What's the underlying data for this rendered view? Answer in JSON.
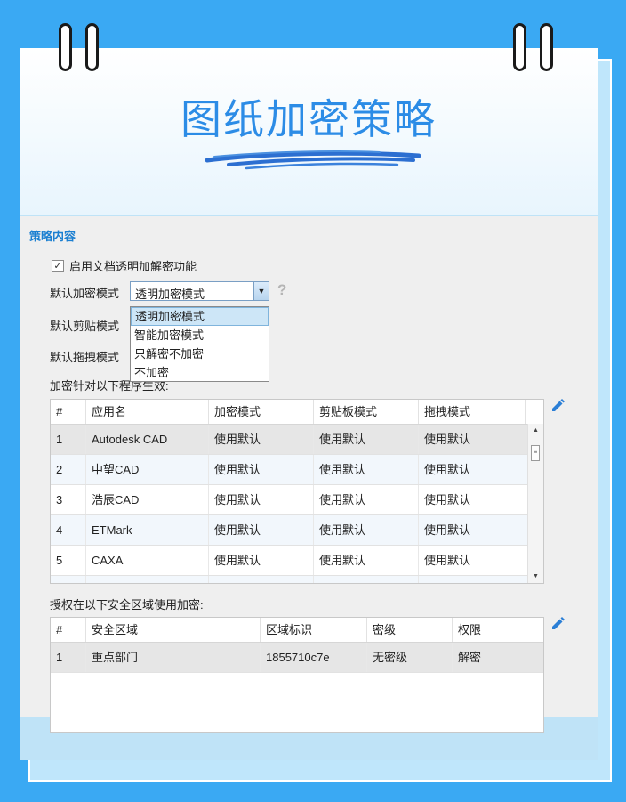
{
  "header": {
    "title": "图纸加密策略"
  },
  "policy": {
    "section_title": "策略内容",
    "enable_checkbox": {
      "label": "启用文档透明加解密功能",
      "checked": true
    },
    "encrypt_mode": {
      "label": "默认加密模式",
      "value": "透明加密模式",
      "options": [
        "透明加密模式",
        "智能加密模式",
        "只解密不加密",
        "不加密"
      ]
    },
    "clipboard_mode_label": "默认剪贴模式",
    "drag_mode_label": "默认拖拽模式",
    "programs_label_visible": "加密针对以下程序生效:",
    "help_glyph": "?"
  },
  "programs_table": {
    "headers": [
      "#",
      "应用名",
      "加密模式",
      "剪贴板模式",
      "拖拽模式"
    ],
    "rows": [
      [
        "1",
        "Autodesk CAD",
        "使用默认",
        "使用默认",
        "使用默认"
      ],
      [
        "2",
        "中望CAD",
        "使用默认",
        "使用默认",
        "使用默认"
      ],
      [
        "3",
        "浩辰CAD",
        "使用默认",
        "使用默认",
        "使用默认"
      ],
      [
        "4",
        "ETMark",
        "使用默认",
        "使用默认",
        "使用默认"
      ],
      [
        "5",
        "CAXA",
        "使用默认",
        "使用默认",
        "使用默认"
      ]
    ]
  },
  "zones": {
    "label": "授权在以下安全区域使用加密:",
    "headers": [
      "#",
      "安全区域",
      "区域标识",
      "密级",
      "权限"
    ],
    "rows": [
      [
        "1",
        "重点部门",
        "1855710c7e",
        "无密级",
        "解密"
      ]
    ]
  },
  "colors": {
    "background": "#3aa9f3",
    "title": "#2c8ce6",
    "accent": "#1b7fd1",
    "selection": "#cde6f7"
  },
  "icons": {
    "edit": "pencil-icon",
    "help": "question-icon",
    "dropdown": "triangle-down-icon"
  }
}
